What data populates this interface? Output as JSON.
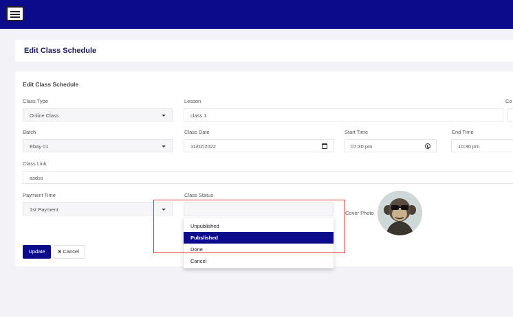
{
  "page": {
    "title": "Edit Class Schedule"
  },
  "form": {
    "section_title": "Edit Class Schedule",
    "class_type": {
      "label": "Class Type",
      "value": "Online Class"
    },
    "lesson": {
      "label": "Lesson",
      "value": "class 1"
    },
    "cut_label": "Co",
    "batch": {
      "label": "Batch",
      "value": "Ebay 01"
    },
    "class_date": {
      "label": "Class Date",
      "value": "11/02/2022"
    },
    "start_time": {
      "label": "Start Time",
      "value": "07:30 pm"
    },
    "end_time": {
      "label": "End Time",
      "value": "10:30 pm"
    },
    "class_link": {
      "label": "Class Link",
      "value": "asdss"
    },
    "payment_time": {
      "label": "Payment Time",
      "value": "1st Payment"
    },
    "class_status": {
      "label": "Class Status",
      "value": "",
      "options": [
        "Unpublished",
        "Pubslished",
        "Done",
        "Cancel"
      ],
      "highlighted_option": "Pubslished"
    },
    "cover_photo": {
      "label": "Cover Photo"
    }
  },
  "actions": {
    "update_label": "Update",
    "cancel_label": "Cancel",
    "cancel_glyph": "✖"
  },
  "icons": {
    "menu": "hamburger-menu-icon",
    "calendar": "calendar-icon",
    "clock": "clock-icon",
    "close": "close-icon"
  },
  "colors": {
    "brand": "#0b0b8c",
    "highlight_box": "#e03030"
  }
}
